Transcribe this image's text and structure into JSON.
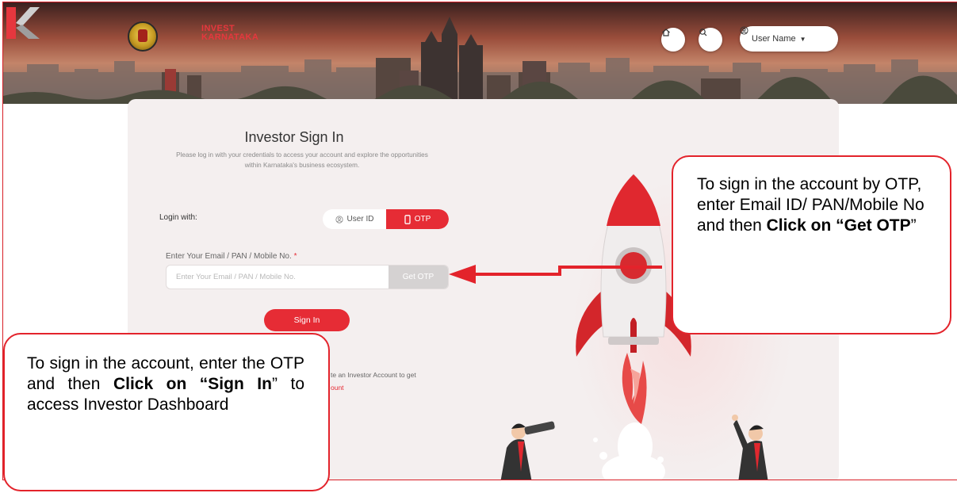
{
  "header": {
    "logo_text_line1": "INVEST",
    "logo_text_line2": "KARNATAKA",
    "user_name": "User Name"
  },
  "signin": {
    "title": "Investor Sign In",
    "subtitle": "Please log in with your credentials to access your account and explore the opportunities within Karnataka's business ecosystem.",
    "login_with_label": "Login with:",
    "option_userid": "User ID",
    "option_otp": "OTP",
    "selected_option": "OTP",
    "field_label": "Enter Your Email / PAN / Mobile No.",
    "field_required_marker": "*",
    "field_placeholder": "Enter Your Email / PAN / Mobile No.",
    "field_value": "",
    "get_otp_label": "Get OTP",
    "signin_label": "Sign In",
    "register_text_partial": "te an Investor Account to get",
    "register_link_partial": "ount"
  },
  "annotations": {
    "right_callout_text": "To sign in the account by OTP, enter Email ID/ PAN/Mobile No and then ",
    "right_callout_bold": "Click on “Get OTP",
    "right_callout_tail": "”",
    "left_callout_text_1": "To sign in the account, enter the OTP and then ",
    "left_callout_bold_1": "Click on “Sign In",
    "left_callout_text_2": "” to access Investor Dashboard"
  },
  "colors": {
    "brand_red": "#e62c35",
    "annotation_red": "#e3232b",
    "card_background": "#f4efef",
    "disabled_button": "#d5d2d2"
  },
  "icons": [
    "state-emblem-icon",
    "invest-karnataka-logo",
    "home-icon",
    "search-icon",
    "user-circle-icon",
    "caret-down-icon",
    "mobile-phone-icon",
    "rocket-illustration",
    "arrow-annotation"
  ]
}
